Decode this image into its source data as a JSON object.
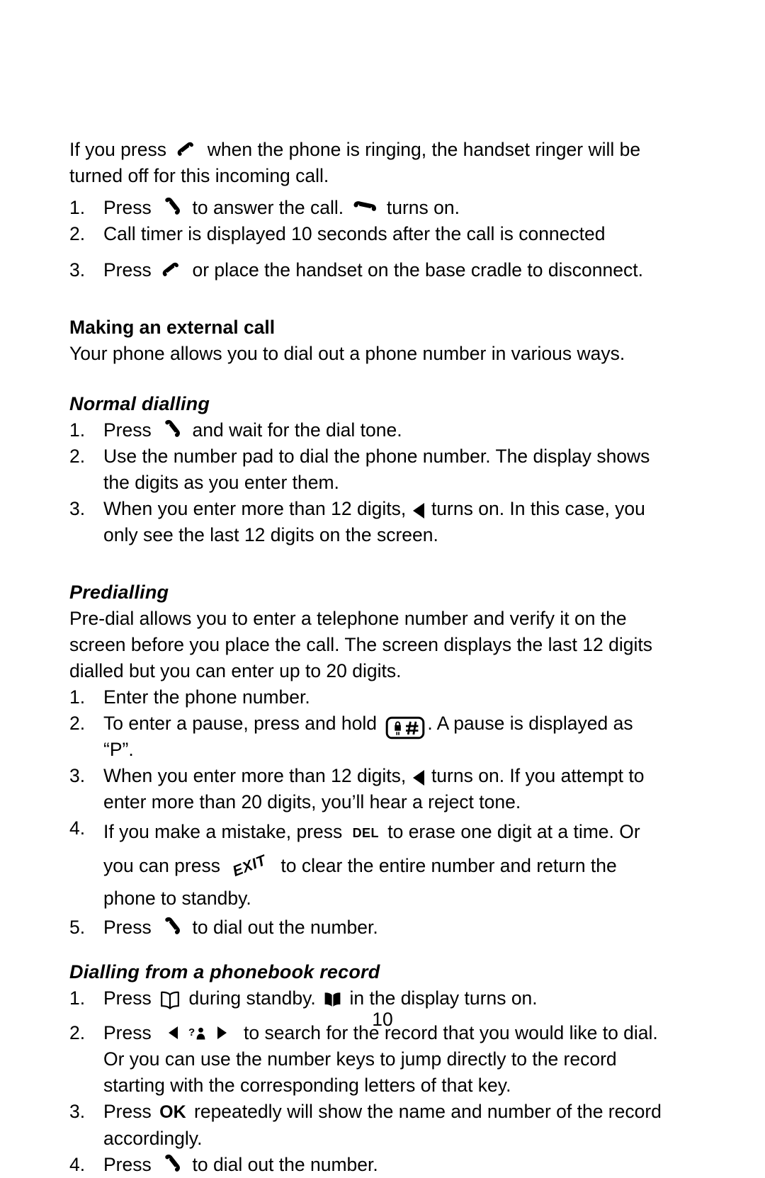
{
  "page": {
    "number": "10"
  },
  "intro": {
    "before_icon": "If you press",
    "icon": "end-call-handset-icon",
    "after_icon": "when the phone is ringing, the handset ringer will be turned off for this incoming call."
  },
  "answer_list": [
    {
      "num": "1.",
      "part1": "Press",
      "icon1": "answer-call-handset-icon",
      "part2": "to answer the call.",
      "icon2": "in-call-handset-icon",
      "part3": "turns on."
    },
    {
      "num": "2.",
      "part1": "Call timer is displayed 10 seconds after the call is connected"
    },
    {
      "num": "3.",
      "part1": "Press",
      "icon1": "end-call-handset-icon",
      "part2": "or place the handset on the base cradle to disconnect."
    }
  ],
  "making_call": {
    "heading": "Making an external call",
    "body": "Your phone allows you to dial out a phone number in various ways."
  },
  "normal_dialling": {
    "heading": "Normal dialling",
    "items": [
      {
        "num": "1.",
        "part1": "Press",
        "icon1": "answer-call-handset-icon",
        "part2": "and wait for the dial tone."
      },
      {
        "num": "2.",
        "part1": "Use the number pad to dial the phone number.  The display shows the digits as you enter them."
      },
      {
        "num": "3.",
        "part1": "When you enter more than 12 digits,",
        "icon1": "left-triangle-indicator-icon",
        "part2": "turns on.  In this case, you only see the last 12 digits on the screen."
      }
    ]
  },
  "predialling": {
    "heading": "Predialling",
    "body": "Pre-dial allows you to enter a telephone number and verify it on the screen before you place the call.  The screen displays the last 12 digits dialled but you can enter up to 20 digits.",
    "items": [
      {
        "num": "1.",
        "part1": "Enter the phone number."
      },
      {
        "num": "2.",
        "part1": "To enter a pause, press and hold",
        "icon1": "pause-hash-key-icon",
        "part2": ".  A pause is displayed as “P”."
      },
      {
        "num": "3.",
        "part1": "When you enter more than 12 digits,",
        "icon1": "left-triangle-indicator-icon",
        "part2": "turns on.  If you attempt to enter more than 20 digits, you’ll hear a reject tone."
      },
      {
        "num": "4.",
        "part1": "If you make a mistake, press",
        "label1": "DEL",
        "part2": "to erase one digit at a time.  Or you can press",
        "label2": "EXIT",
        "part3": "to clear the entire number and return the phone to standby."
      },
      {
        "num": "5.",
        "part1": "Press",
        "icon1": "answer-call-handset-icon",
        "part2": "to dial out the number."
      }
    ]
  },
  "phonebook_dialling": {
    "heading": "Dialling from a phonebook record",
    "items": [
      {
        "num": "1.",
        "part1": "Press",
        "icon1": "phonebook-outline-icon",
        "part2": "during standby.",
        "icon2": "phonebook-solid-icon",
        "part3": "in the display turns on."
      },
      {
        "num": "2.",
        "part1": "Press",
        "icon1": "nav-left-arrow-icon",
        "icon2": "search-person-icon",
        "icon3": "nav-right-arrow-icon",
        "part2": "to search for the record that you would like to dial. Or you can use the number keys to jump directly to the record starting with the corresponding letters of that key."
      },
      {
        "num": "3.",
        "part1": "Press",
        "label1": "OK",
        "part2": "repeatedly will show the name and number of the record accordingly."
      },
      {
        "num": "4.",
        "part1": "Press",
        "icon1": "answer-call-handset-icon",
        "part2": "to dial out the number."
      }
    ]
  }
}
